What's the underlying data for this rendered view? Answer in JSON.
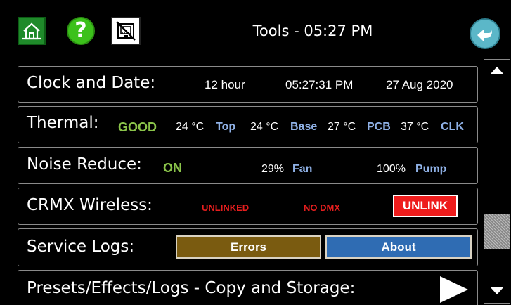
{
  "header": {
    "title": "Tools - 05:27 PM",
    "icons": {
      "home": "home-icon",
      "help": "help-icon",
      "help_glyph": "?",
      "network": "network-disconnected-icon",
      "back": "back-arrow-icon"
    }
  },
  "rows": {
    "clock": {
      "label": "Clock and Date:",
      "format": "12 hour",
      "time": "05:27:31 PM",
      "date": "27 Aug 2020"
    },
    "thermal": {
      "label": "Thermal:",
      "status": "GOOD",
      "sensors": [
        {
          "temp": "24 °C",
          "name": "Top"
        },
        {
          "temp": "24 °C",
          "name": "Base"
        },
        {
          "temp": "27 °C",
          "name": "PCB"
        },
        {
          "temp": "37 °C",
          "name": "CLK"
        }
      ]
    },
    "noise": {
      "label": "Noise Reduce:",
      "status": "ON",
      "fan_value": "29%",
      "fan_label": "Fan",
      "pump_value": "100%",
      "pump_label": "Pump"
    },
    "crmx": {
      "label": "CRMX Wireless:",
      "link_status": "UNLINKED",
      "dmx_status": "NO DMX",
      "unlink_button": "UNLINK"
    },
    "service": {
      "label": "Service Logs:",
      "errors_button": "Errors",
      "about_button": "About"
    },
    "presets": {
      "label": "Presets/Effects/Logs - Copy and Storage:"
    }
  },
  "scrollbar": {
    "position": 0.82
  },
  "colors": {
    "home_bg": "#1f8a2a",
    "help_bg": "#3cc11b",
    "back_bg": "#5bb7c8",
    "status_green": "#8ac34a",
    "label_blue": "#8fb1e6",
    "alert_red": "#e61e1e",
    "errors_bg": "#7a5b10",
    "about_bg": "#2f6cb3"
  }
}
